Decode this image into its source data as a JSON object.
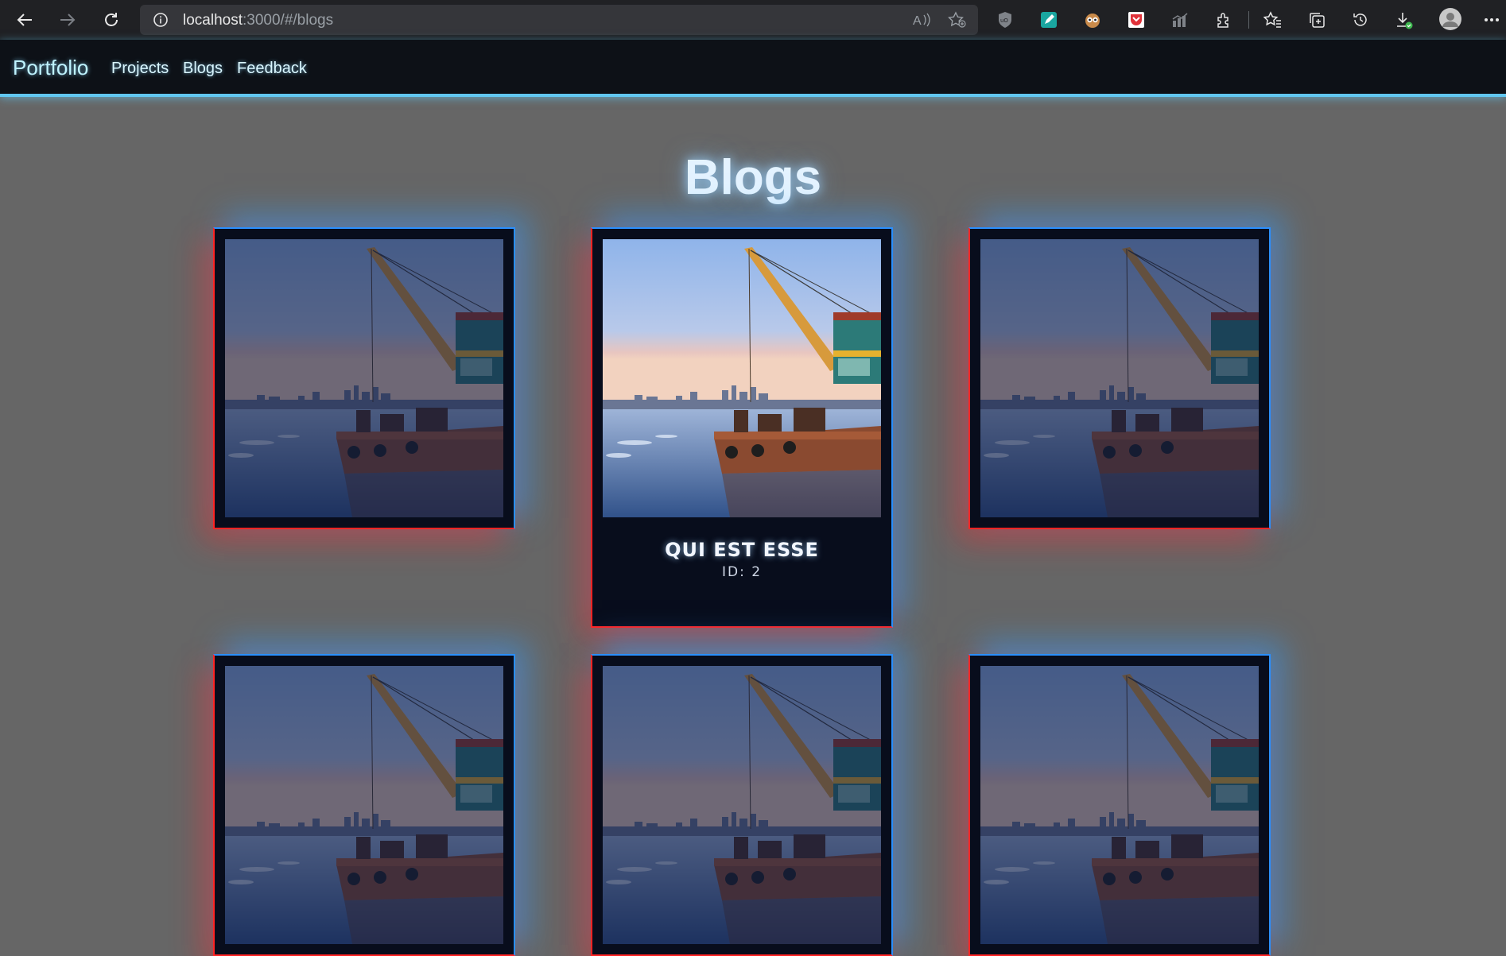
{
  "browser": {
    "url_host": "localhost",
    "url_rest": ":3000/#/blogs"
  },
  "navbar": {
    "brand": "Portfolio",
    "links": [
      "Projects",
      "Blogs",
      "Feedback"
    ]
  },
  "page": {
    "title": "Blogs"
  },
  "cards": [
    {
      "title": "QUI EST ESSE",
      "id_label": "ID: 2",
      "hovered": true
    }
  ],
  "colors": {
    "background": "#666666",
    "navbar": "#0d1117",
    "card_bg": "#080d1c",
    "accent_blue": "#2a8fff",
    "accent_red": "#ff2424",
    "nav_underline": "#61c7f0"
  }
}
